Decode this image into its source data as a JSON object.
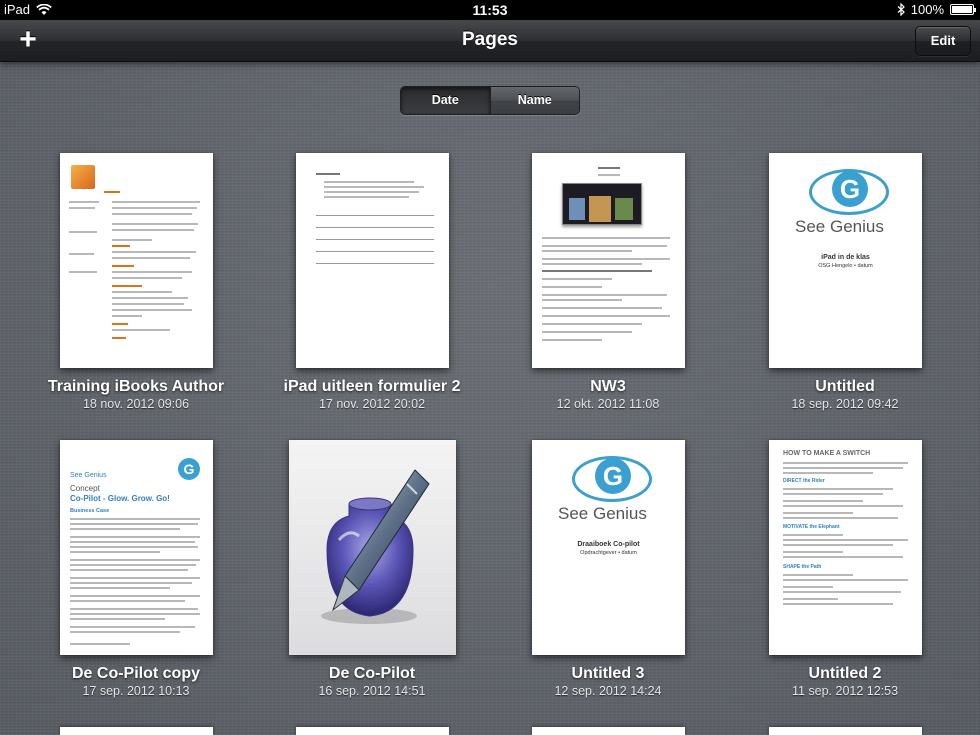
{
  "status_bar": {
    "device": "iPad",
    "time": "11:53",
    "battery": "100%",
    "battery_level": 1.0
  },
  "nav_bar": {
    "title": "Pages",
    "add_label": "+",
    "edit_label": "Edit"
  },
  "sort_control": {
    "options": [
      "Date",
      "Name"
    ],
    "selected": "Date"
  },
  "documents": [
    {
      "title": "Training iBooks Author",
      "date": "18 nov. 2012 09:06"
    },
    {
      "title": "iPad uitleen formulier 2",
      "date": "17 nov. 2012 20:02"
    },
    {
      "title": "NW3",
      "date": "12 okt. 2012 11:08"
    },
    {
      "title": "Untitled",
      "date": "18 sep. 2012 09:42"
    },
    {
      "title": "De Co-Pilot copy",
      "date": "17 sep. 2012 10:13"
    },
    {
      "title": "De Co-Pilot",
      "date": "16 sep. 2012 14:51"
    },
    {
      "title": "Untitled 3",
      "date": "12 sep. 2012 14:24"
    },
    {
      "title": "Untitled 2",
      "date": "11 sep. 2012 12:53"
    }
  ],
  "thumbnails": {
    "see_genius": "See Genius",
    "untitled_sub1": "iPad in de klas",
    "untitled_sub2": "OSG Hengelo • datum",
    "untitled3_sub1": "Draaiboek Co-pilot",
    "untitled3_sub2": "Opdrachtgever • datum",
    "copilot_concept": "Concept",
    "copilot_heading": "Co-Pilot - Glow. Grow. Go!",
    "copilot_case": "Business Case",
    "untitled2_heading": "HOW TO MAKE A SWITCH",
    "untitled2_sections": [
      "DIRECT the Rider",
      "MOTIVATE the Elephant",
      "SHAPE the Path"
    ]
  },
  "icons": {
    "wifi": "wifi-icon",
    "bluetooth": "bluetooth-icon",
    "battery": "battery-icon",
    "pages_app": "pages-inkwell-icon"
  },
  "colors": {
    "background": "#5d6168",
    "navbar": "#2f3033",
    "accent_blue": "#3aa0d2",
    "accent_orange": "#d8741e"
  }
}
